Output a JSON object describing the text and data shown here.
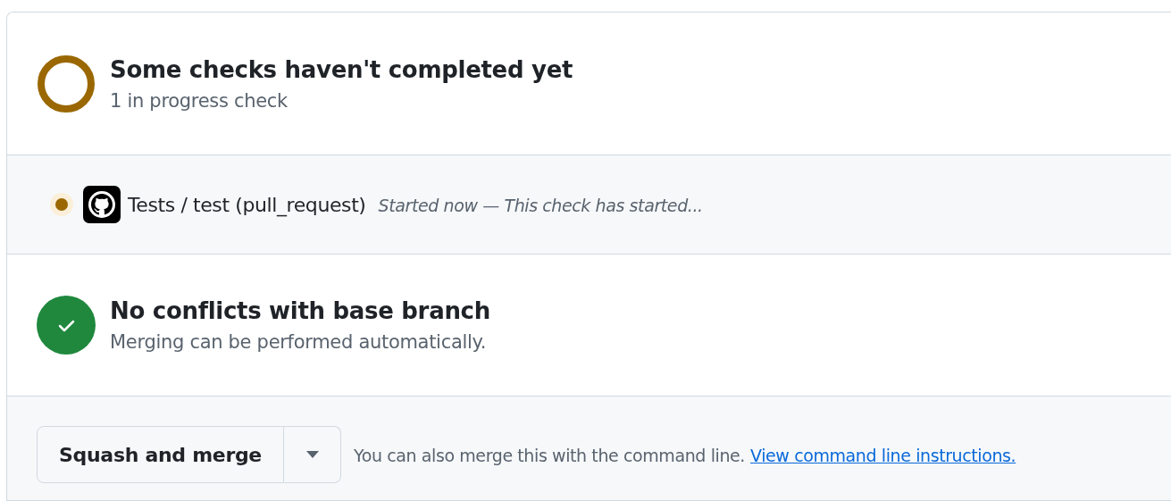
{
  "summary": {
    "kind": "pending",
    "title": "Some checks haven't completed yet",
    "subtitle": "1 in progress check"
  },
  "checks": [
    {
      "kind": "pending",
      "name": "Tests / test (pull_request)",
      "description": "Started now — This check has started..."
    }
  ],
  "merge_status": {
    "kind": "success",
    "title": "No conflicts with base branch",
    "subtitle": "Merging can be performed automatically."
  },
  "merge_box": {
    "button": "Squash and merge",
    "note": "You can also merge this with the command line.",
    "link": "View command line instructions."
  }
}
